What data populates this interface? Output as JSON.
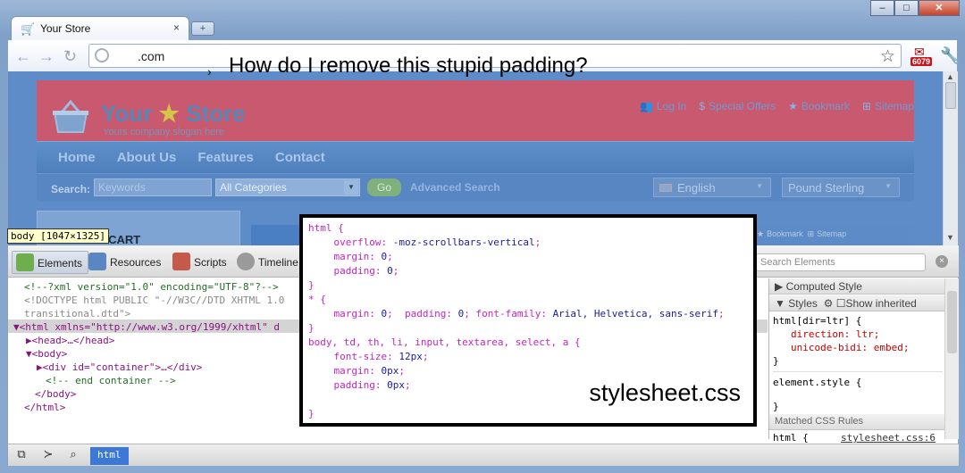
{
  "browser": {
    "tab_title": "Your Store",
    "tab_close": "×",
    "new_tab": "+",
    "url": ".com",
    "ext_badge": "6079",
    "window_buttons": {
      "minimize": "–",
      "maximize": "□",
      "close": "✕"
    }
  },
  "annotation": {
    "question": "How do I remove this stupid padding?"
  },
  "store": {
    "logo_your": "Your",
    "logo_store": "Store",
    "slogan": "Yours company slogan here",
    "top_links": [
      "Log In",
      "Special Offers",
      "Bookmark",
      "Sitemap"
    ],
    "menu": [
      "Home",
      "About Us",
      "Features",
      "Contact"
    ],
    "search_label": "Search:",
    "keywords_placeholder": "Keywords",
    "category_value": "All Categories",
    "go": "Go",
    "advanced_search": "Advanced Search",
    "language": "English",
    "currency": "Pound Sterling",
    "cart_title": "NG CART",
    "mini_links": [
      "Bookmark",
      "Sitemap"
    ]
  },
  "tooltip": "body [1047×1325]",
  "devtools": {
    "tabs": [
      "Elements",
      "Resources",
      "Scripts",
      "Timeline"
    ],
    "search_placeholder": "Search Elements",
    "dom_lines": [
      "<!--?xml version=\"1.0\" encoding=\"UTF-8\"?-->",
      "<!DOCTYPE html PUBLIC \"-//W3C//DTD XHTML 1.0",
      "transitional.dtd\">",
      "▼<html xmlns=\"http://www.w3.org/1999/xhtml\" d",
      "▶<head>…</head>",
      "▼<body>",
      "▶<div id=\"container\">…</div>",
      "<!-- end container -->",
      "</body>",
      "</html>"
    ],
    "computed_style": "Computed Style",
    "styles": "Styles",
    "show_inherited": "Show inherited",
    "html_rule_selector": "html[dir=ltr] {",
    "html_rule_lines": [
      "direction: ltr;",
      "unicode-bidi: embed;"
    ],
    "close_brace": "}",
    "element_style": "element.style {",
    "matched_css_rules": "Matched CSS Rules",
    "matched_rule": "html {",
    "matched_source": "stylesheet.css:6",
    "breadcrumb": "html"
  },
  "stylesheet": {
    "file_name": "stylesheet.css",
    "lines": [
      "html {",
      "    overflow: -moz-scrollbars-vertical;",
      "    margin: 0;",
      "    padding: 0;",
      "}",
      "* {",
      "    margin: 0;  padding: 0; font-family: Arial, Helvetica, sans-serif;",
      "}",
      "body, td, th, li, input, textarea, select, a {",
      "    font-size: 12px;",
      "    margin: 0px;",
      "    padding: 0px;",
      "",
      "}"
    ]
  },
  "colors": {
    "store_header": "#c9596e",
    "store_menu": "#5e8fc9",
    "selection": "#3c78d8"
  }
}
